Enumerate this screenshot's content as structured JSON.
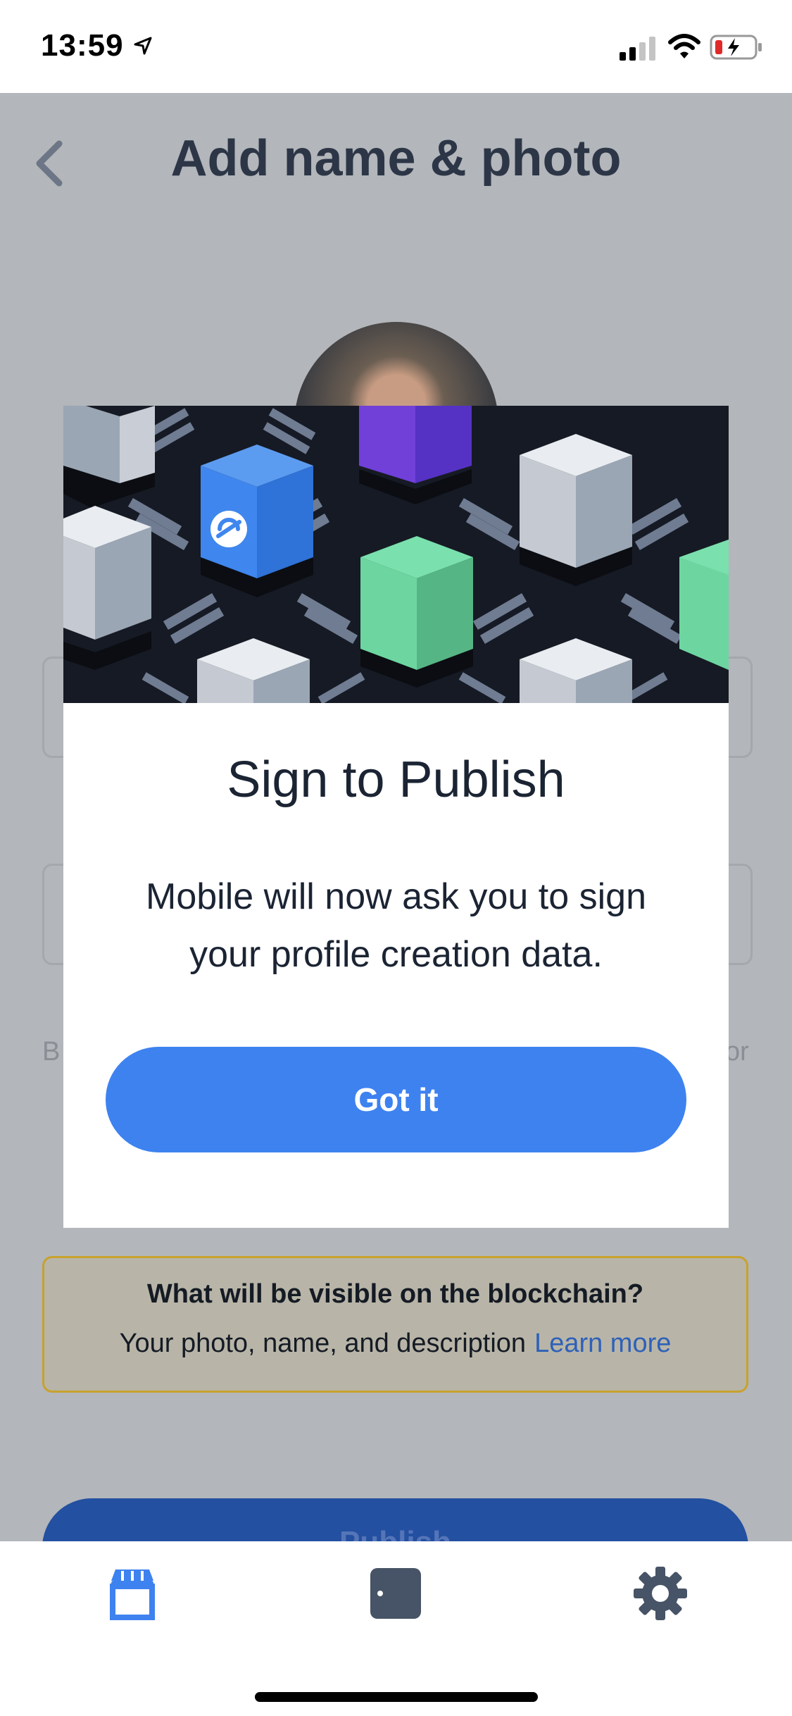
{
  "status_bar": {
    "time": "13:59"
  },
  "header": {
    "title": "Add name & photo"
  },
  "page": {
    "peek_left": "B",
    "peek_right": "or",
    "info": {
      "title": "What will be visible on the blockchain?",
      "body": "Your photo, name, and description",
      "link": "Learn more"
    },
    "publish_label": "Publish"
  },
  "modal": {
    "title": "Sign to Publish",
    "body": "Mobile will now ask you to sign your profile creation data.",
    "button": "Got it"
  },
  "tabs": [
    {
      "icon": "storefront-icon"
    },
    {
      "icon": "wallet-card-icon"
    },
    {
      "icon": "gear-icon"
    }
  ],
  "colors": {
    "accent": "#3e82f0",
    "title_text": "#2c3647",
    "overlay_bg": "#b3b6ba",
    "info_border": "#c8a22e",
    "link": "#2e61b8",
    "tab_active": "#3e82f0",
    "tab_inactive": "#475366"
  }
}
